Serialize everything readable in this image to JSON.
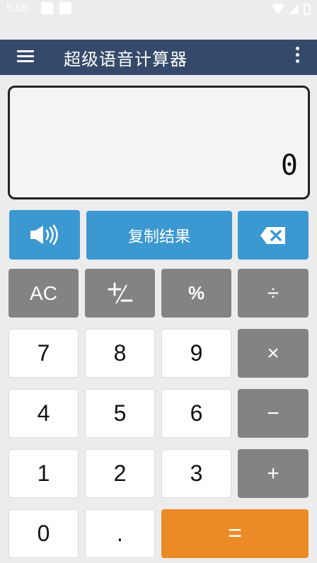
{
  "status_bar": {
    "time": "5:05",
    "icons": [
      "notification-square-icon",
      "notification-square-icon",
      "wifi-icon",
      "signal-icon",
      "battery-icon"
    ]
  },
  "app_bar": {
    "title": "超级语音计算器",
    "menu_icon": "hamburger-menu-icon",
    "more_icon": "more-vert-icon",
    "color": "#354a6b"
  },
  "display": {
    "value": "0"
  },
  "actions": {
    "speaker_icon": "speaker-icon",
    "copy_label": "复制结果",
    "backspace_icon": "backspace-icon"
  },
  "keys": {
    "clear": "AC",
    "plus_minus": "+/−",
    "percent": "%",
    "divide": "÷",
    "multiply": "×",
    "minus": "−",
    "plus": "+",
    "equals": "=",
    "dot": ".",
    "d7": "7",
    "d8": "8",
    "d9": "9",
    "d4": "4",
    "d5": "5",
    "d6": "6",
    "d1": "1",
    "d2": "2",
    "d3": "3",
    "d0": "0"
  },
  "colors": {
    "accent_blue": "#3b98d1",
    "operator_gray": "#838383",
    "equals_orange": "#ec8b25",
    "background": "#ececec"
  }
}
